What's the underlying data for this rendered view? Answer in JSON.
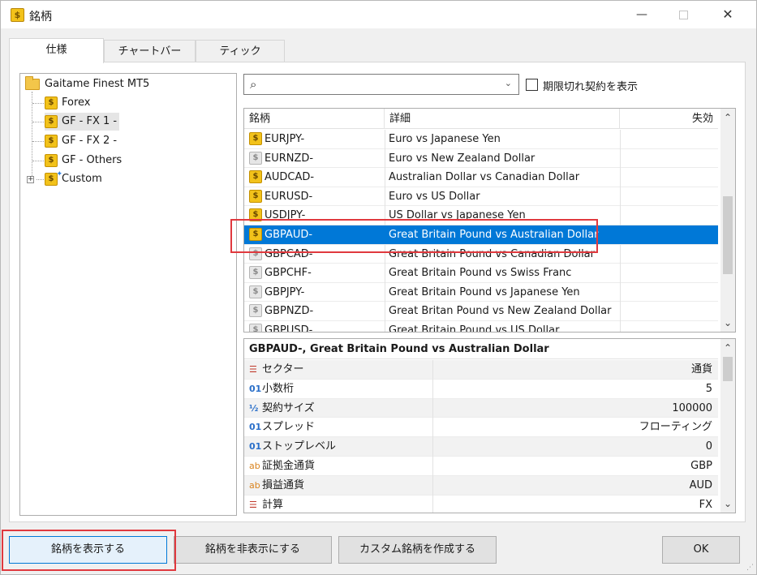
{
  "window": {
    "title": "銘柄",
    "minimize_glyph": "—",
    "close_glyph": "✕"
  },
  "tabs": [
    {
      "label": "仕様",
      "active": true
    },
    {
      "label": "チャートバー",
      "active": false
    },
    {
      "label": "ティック",
      "active": false
    }
  ],
  "tree": {
    "root": "Gaitame Finest MT5",
    "children": [
      "Forex",
      "GF - FX 1 -",
      "GF - FX 2 -",
      "GF - Others",
      "Custom"
    ],
    "selected": "GF - FX 1 -"
  },
  "search": {
    "value": "",
    "placeholder": ""
  },
  "expired_checkbox": {
    "label": "期限切れ契約を表示",
    "checked": false
  },
  "symbols_table": {
    "columns": [
      "銘柄",
      "詳細",
      "失効"
    ],
    "rows": [
      {
        "symbol": "EURJPY-",
        "description": "Euro vs Japanese Yen",
        "icon": "gold"
      },
      {
        "symbol": "EURNZD-",
        "description": "Euro vs New Zealand Dollar",
        "icon": "grey"
      },
      {
        "symbol": "AUDCAD-",
        "description": "Australian Dollar vs Canadian Dollar",
        "icon": "gold"
      },
      {
        "symbol": "EURUSD-",
        "description": "Euro vs US Dollar",
        "icon": "gold"
      },
      {
        "symbol": "USDJPY-",
        "description": "US Dollar vs Japanese Yen",
        "icon": "gold"
      },
      {
        "symbol": "GBPAUD-",
        "description": "Great Britain Pound vs Australian Dollar",
        "icon": "gold",
        "selected": true
      },
      {
        "symbol": "GBPCAD-",
        "description": "Great Britain Pound vs Canadian Dollar",
        "icon": "grey"
      },
      {
        "symbol": "GBPCHF-",
        "description": "Great Britain Pound vs Swiss Franc",
        "icon": "grey"
      },
      {
        "symbol": "GBPJPY-",
        "description": "Great Britain Pound vs Japanese Yen",
        "icon": "grey"
      },
      {
        "symbol": "GBPNZD-",
        "description": "Great Britan Pound vs New Zealand Dollar",
        "icon": "grey"
      },
      {
        "symbol": "GBPUSD-",
        "description": "Great Britain Pound vs US Dollar",
        "icon": "grey"
      }
    ]
  },
  "properties": {
    "header": "GBPAUD-, Great Britain Pound vs Australian Dollar",
    "rows": [
      {
        "icon": "list",
        "glyph": "☰",
        "key": "セクター",
        "value": "通貨"
      },
      {
        "icon": "num",
        "glyph": "01",
        "key": "小数桁",
        "value": "5"
      },
      {
        "icon": "half",
        "glyph": "½",
        "key": "契約サイズ",
        "value": "100000"
      },
      {
        "icon": "num",
        "glyph": "01",
        "key": "スプレッド",
        "value": "フローティング"
      },
      {
        "icon": "num",
        "glyph": "01",
        "key": "ストップレベル",
        "value": "0"
      },
      {
        "icon": "ab",
        "glyph": "ab",
        "key": "証拠金通貨",
        "value": "GBP"
      },
      {
        "icon": "ab",
        "glyph": "ab",
        "key": "損益通貨",
        "value": "AUD"
      },
      {
        "icon": "list",
        "glyph": "☰",
        "key": "計算",
        "value": "FX"
      }
    ]
  },
  "buttons": {
    "show": "銘柄を表示する",
    "hide": "銘柄を非表示にする",
    "create_custom": "カスタム銘柄を作成する",
    "ok": "OK"
  },
  "colors": {
    "selection": "#0078d7",
    "highlight_box": "#e0393e",
    "symbol_icon": "#f2c21a"
  }
}
